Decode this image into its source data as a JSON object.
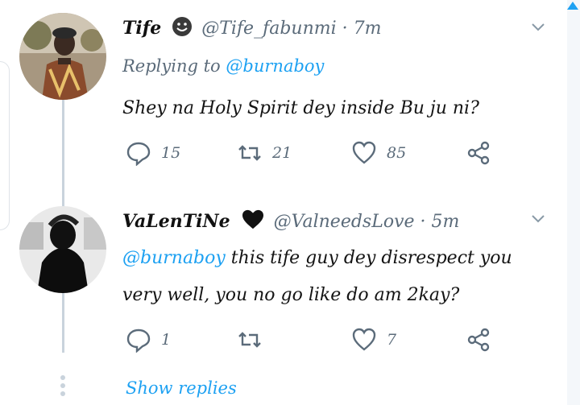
{
  "tweets": [
    {
      "name": "Tife",
      "handle": "@Tife_fabunmi",
      "separator": "·",
      "time": "7m",
      "replying_label": "Replying to",
      "replying_handle": "@burnaboy",
      "text": "Shey na Holy Spirit dey inside Bu ju ni?",
      "replies": "15",
      "retweets": "21",
      "likes": "85"
    },
    {
      "name": "VaLenTiNe",
      "handle": "@ValneedsLove",
      "separator": "·",
      "time": "5m",
      "mention": "@burnaboy",
      "text_line1": " this tife guy dey disrespect you",
      "text_line2": "very well, you no go like do am 2kay?",
      "replies": "1",
      "retweets": "",
      "likes": "7"
    }
  ],
  "show_replies_label": "Show replies",
  "colors": {
    "accent": "#1da1f2",
    "muted": "#5b6b7a",
    "thread": "#c9d3dc"
  },
  "icons": [
    "reply-icon",
    "retweet-icon",
    "like-icon",
    "share-icon",
    "chevron-down-icon",
    "smiling-emoji-icon",
    "black-heart-icon"
  ]
}
